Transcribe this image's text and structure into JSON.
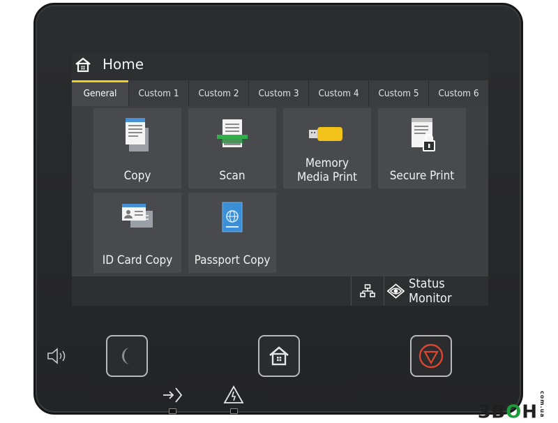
{
  "header": {
    "title": "Home",
    "icon": "home-icon"
  },
  "tabs": [
    {
      "label": "General",
      "active": true
    },
    {
      "label": "Custom 1",
      "active": false
    },
    {
      "label": "Custom 2",
      "active": false
    },
    {
      "label": "Custom 3",
      "active": false
    },
    {
      "label": "Custom 4",
      "active": false
    },
    {
      "label": "Custom 5",
      "active": false
    },
    {
      "label": "Custom 6",
      "active": false
    }
  ],
  "tiles": [
    {
      "label_line1": "Copy",
      "label_line2": "",
      "icon": "copy-icon"
    },
    {
      "label_line1": "Scan",
      "label_line2": "",
      "icon": "scan-icon"
    },
    {
      "label_line1": "Memory",
      "label_line2": "Media Print",
      "icon": "usb-memory-icon"
    },
    {
      "label_line1": "Secure Print",
      "label_line2": "",
      "icon": "secure-print-icon"
    },
    {
      "label_line1": "ID Card Copy",
      "label_line2": "",
      "icon": "id-card-icon"
    },
    {
      "label_line1": "Passport Copy",
      "label_line2": "",
      "icon": "passport-icon"
    }
  ],
  "status_bar": {
    "network_icon": "network-icon",
    "status_monitor_label": "Status Monitor",
    "status_monitor_icon": "eye-icon"
  },
  "hardware": {
    "volume_icon": "speaker-icon",
    "sleep_icon": "moon-icon",
    "home_icon": "home-icon",
    "stop_icon": "stop-icon",
    "data_led_icon": "data-in-icon",
    "error_led_icon": "warning-icon"
  },
  "watermark": {
    "text_a": "ЗВ",
    "text_o": "O",
    "text_b": "H",
    "small": "com.ua"
  },
  "colors": {
    "accent_tab": "#f1d21a",
    "stop_red": "#e0452f",
    "scan_green": "#2fae4a",
    "usb_yellow": "#f2c21b",
    "passport_blue": "#3b8fd6"
  }
}
